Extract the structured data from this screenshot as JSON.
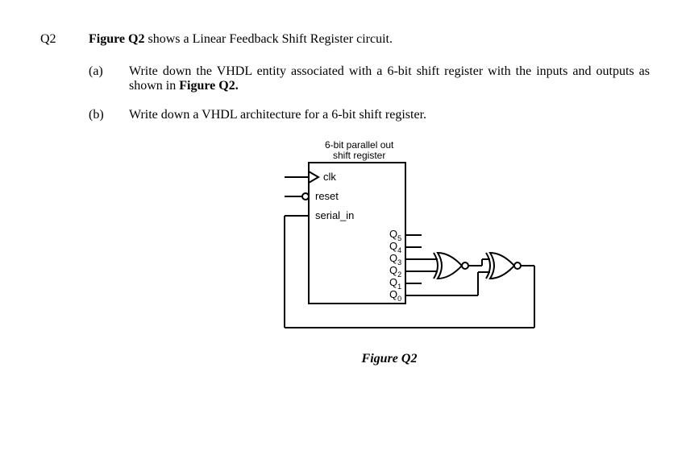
{
  "question_label": "Q2",
  "intro_prefix": "Figure Q2",
  "intro_rest": " shows a Linear Feedback Shift Register circuit.",
  "parts": {
    "a": {
      "label": "(a)",
      "text_pre": "Write down the VHDL entity associated with a 6-bit shift register with the inputs and outputs as shown in ",
      "text_bold": "Figure Q2.",
      "text_post": ""
    },
    "b": {
      "label": "(b)",
      "text": "Write down a VHDL architecture for a 6-bit shift register."
    }
  },
  "figure": {
    "title_line1": "6-bit parallel out",
    "title_line2": "shift register",
    "pins": {
      "clk": "clk",
      "reset": "reset",
      "serial_in": "serial_in"
    },
    "outputs": {
      "q5": "Q",
      "q5_sub": "5",
      "q4": "Q",
      "q4_sub": "4",
      "q3": "Q",
      "q3_sub": "3",
      "q2": "Q",
      "q2_sub": "2",
      "q1": "Q",
      "q1_sub": "1",
      "q0": "Q",
      "q0_sub": "0"
    },
    "caption": "Figure Q2"
  }
}
